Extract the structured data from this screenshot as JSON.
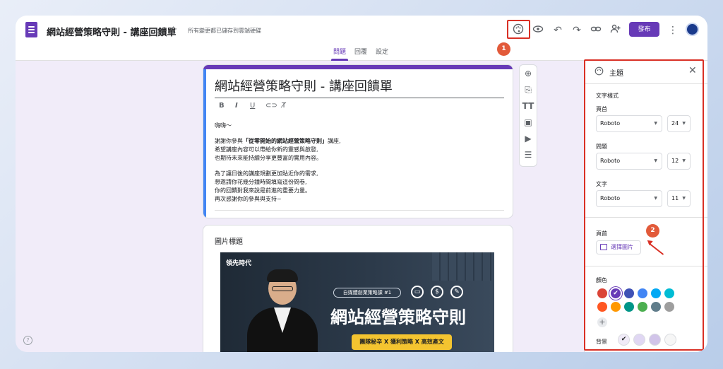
{
  "header": {
    "doc_title": "網站經營策略守則 - 講座回饋單",
    "save_status": "所有變更都已儲存到雲端硬碟",
    "publish_label": "發布",
    "icons": [
      "folder-icon",
      "star-icon",
      "palette-icon",
      "eye-icon",
      "undo-icon",
      "redo-icon",
      "link-icon",
      "add-person-icon",
      "more-icon",
      "avatar"
    ]
  },
  "tabs": [
    {
      "label": "問題",
      "active": true
    },
    {
      "label": "回覆",
      "active": false
    },
    {
      "label": "設定",
      "active": false
    }
  ],
  "form": {
    "title": "網站經營策略守則 - 講座回饋單",
    "format_tools": [
      "B",
      "I",
      "U",
      "link",
      "clear"
    ],
    "description": {
      "greeting": "嗨嗨～",
      "p1_line1_pre": "謝謝你參與",
      "p1_line1_bold": "「從零開始的網站經營策略守則」",
      "p1_line1_post": "講座,",
      "p1_line2": "希望講座內容可以帶給你新的靈感與啟發,",
      "p1_line3": "也期待未來能持續分享更豐富的實用內容。",
      "p2_line1": "為了讓日後的講座規劃更加貼近你的需求,",
      "p2_line2": "想邀請你花幾分鐘時間填寫這份問卷,",
      "p2_line3": "你的回饋對我來說是前進的重要力量。",
      "p2_line4": "再次感謝你的參與與支持~"
    }
  },
  "image_card": {
    "title": "圖片標題",
    "banner": {
      "logo": "領先時代",
      "tag": "自媒體創業策略課 #1",
      "headline": "網站經營策略守則",
      "subline": "團隊秘辛 X 獲利策略 X 高效產文"
    }
  },
  "theme_panel": {
    "title": "主題",
    "text_style_label": "文字樣式",
    "header_label": "頁首",
    "header_font": "Roboto",
    "header_size": "24",
    "question_label": "問題",
    "question_font": "Roboto",
    "question_size": "12",
    "text_label": "文字",
    "text_font": "Roboto",
    "text_size": "11",
    "header_image_label": "頁首",
    "choose_image_label": "選擇圖片",
    "color_label": "顏色",
    "background_label": "背景",
    "colors": [
      "#db4437",
      "#673ab7",
      "#3f51b5",
      "#4285f4",
      "#03a9f4",
      "#00bcd4",
      "#ff5722",
      "#ff9800",
      "#009688",
      "#4caf50",
      "#607d8b",
      "#9e9e9e"
    ],
    "selected_color": "#673ab7",
    "backgrounds": [
      "#f0ebf8",
      "#e0d7f3",
      "#d1c4e9",
      "#f6f6f6"
    ]
  },
  "annotations": {
    "badge1": "1",
    "badge2": "2"
  }
}
